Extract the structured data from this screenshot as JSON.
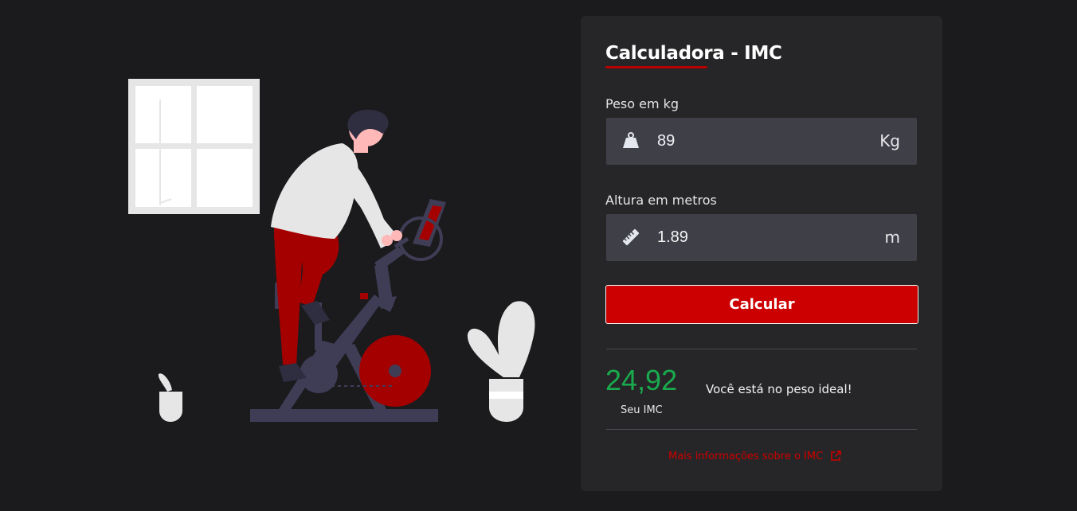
{
  "colors": {
    "background": "#1b1b1e",
    "card": "#262628",
    "accent": "#cc0000",
    "input_bg": "#3f3f47",
    "imc_good": "#1aaa4e"
  },
  "calculator": {
    "title": "Calculadora - IMC",
    "weight": {
      "label": "Peso em kg",
      "value": "89",
      "unit": "Kg",
      "icon": "weight-icon"
    },
    "height": {
      "label": "Altura em metros",
      "value": "1.89",
      "unit": "m",
      "icon": "ruler-icon"
    },
    "button_label": "Calcular",
    "result": {
      "value": "24,92",
      "caption": "Seu IMC",
      "message": "Você está no peso ideal!"
    },
    "more_info": {
      "label": "Mais informações sobre o IMC",
      "icon": "external-link-icon"
    }
  },
  "illustration": {
    "icon": "exercise-bike-illustration"
  }
}
